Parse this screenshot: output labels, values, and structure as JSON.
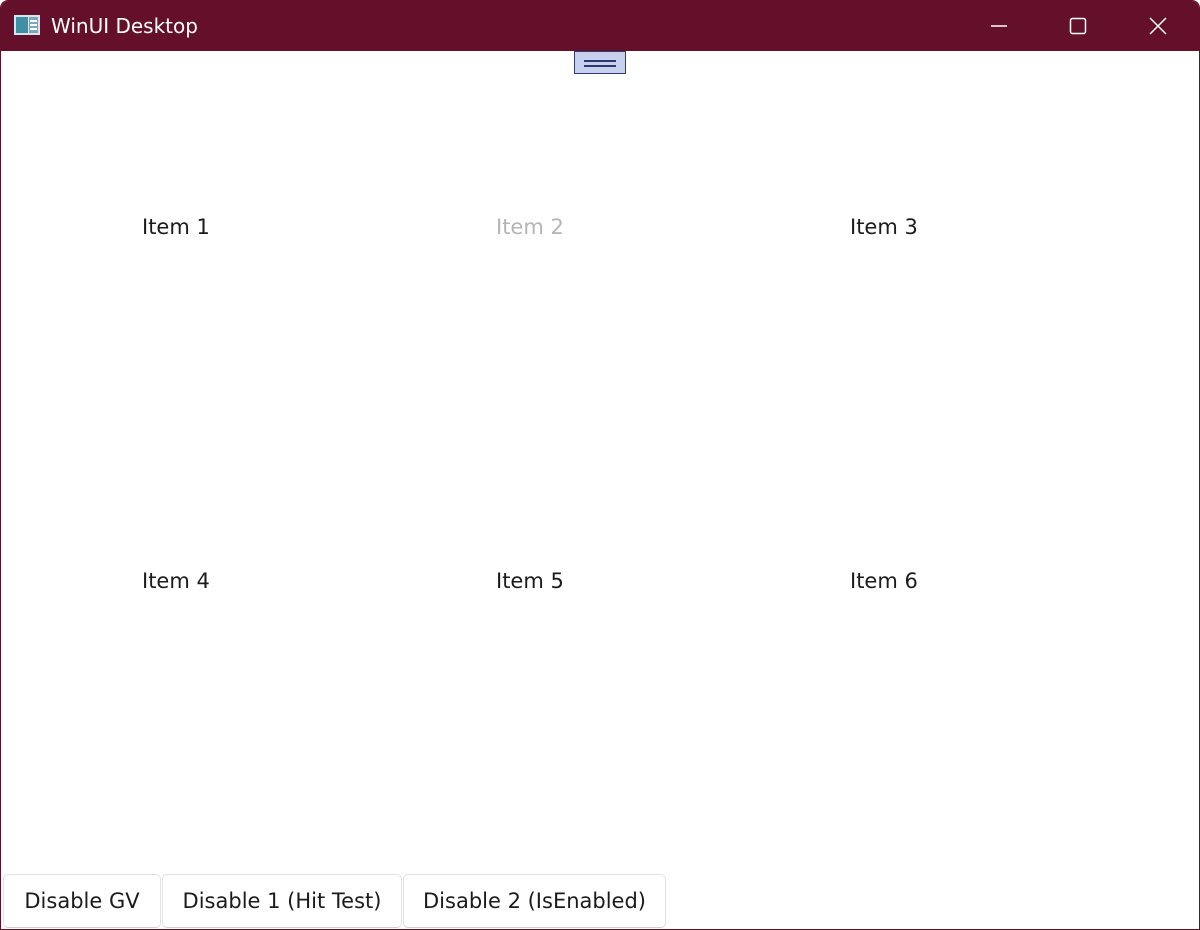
{
  "window": {
    "title": "WinUI Desktop",
    "accent_color": "#65102b",
    "icons": {
      "app": "app-window-icon",
      "minimize": "minimize-icon",
      "maximize": "maximize-icon",
      "close": "close-icon"
    }
  },
  "grid": {
    "drag_handle_icon": "drag-handle-icon",
    "items": [
      {
        "label": "Item 1",
        "state": "enabled"
      },
      {
        "label": "Item 2",
        "state": "disabled"
      },
      {
        "label": "Item 3",
        "state": "enabled"
      },
      {
        "label": "Item 4",
        "state": "enabled"
      },
      {
        "label": "Item 5",
        "state": "enabled"
      },
      {
        "label": "Item 6",
        "state": "enabled"
      }
    ]
  },
  "toolbar": {
    "buttons": [
      {
        "label": "Disable GV"
      },
      {
        "label": "Disable 1 (Hit Test)"
      },
      {
        "label": "Disable 2 (IsEnabled)"
      }
    ]
  }
}
